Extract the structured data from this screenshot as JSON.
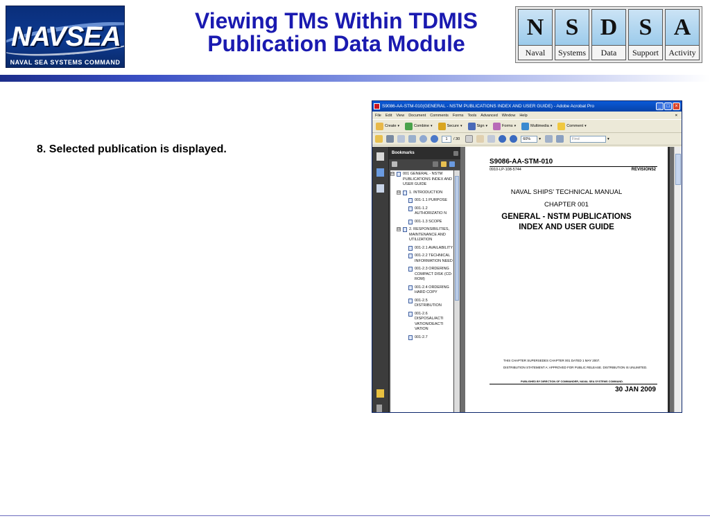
{
  "header": {
    "logo": {
      "word": "NAVSEA",
      "subtitle": "NAVAL SEA SYSTEMS COMMAND"
    },
    "title_line1": "Viewing TMs Within TDMIS",
    "title_line2": "Publication Data Module",
    "nsdsa": [
      {
        "letter": "N",
        "word": "Naval"
      },
      {
        "letter": "S",
        "word": "Systems"
      },
      {
        "letter": "D",
        "word": "Data"
      },
      {
        "letter": "S",
        "word": "Support"
      },
      {
        "letter": "A",
        "word": "Activity"
      }
    ]
  },
  "bullet": "8. Selected publication is displayed.",
  "acrobat": {
    "title": "S9086-AA-STM-010(GENERAL - NSTM PUBLICATIONS INDEX AND USER GUIDE) - Adobe Acrobat Pro",
    "window_buttons": {
      "minimize": "_",
      "maximize": "□",
      "close": "×"
    },
    "menu": [
      "File",
      "Edit",
      "View",
      "Document",
      "Comments",
      "Forms",
      "Tools",
      "Advanced",
      "Window",
      "Help"
    ],
    "menu_close": "×",
    "toolbar": [
      "Create",
      "Combine",
      "Secure",
      "Sign",
      "Forms",
      "Multimedia",
      "Comment"
    ],
    "page_current": "1",
    "page_total": "/ 30",
    "zoom": "60%",
    "find_placeholder": "Find",
    "bookmarks_title": "Bookmarks",
    "bookmarks": [
      {
        "label": "001   GENERAL - NSTM PUBLICATIONS INDEX AND USER GUIDE",
        "level": 0,
        "expander": "⊟"
      },
      {
        "label": "1. INTRODUCTION",
        "level": 1,
        "expander": "⊟"
      },
      {
        "label": "001-1.1 PURPOSE",
        "level": 2,
        "expander": ""
      },
      {
        "label": "001-1.2 AUTHORIZATIO N",
        "level": 2,
        "expander": ""
      },
      {
        "label": "001-1.3   SCOPE",
        "level": 2,
        "expander": ""
      },
      {
        "label": "2. RESPONSIBILITIES, MAINTENANCE AND UTILIZATION",
        "level": 1,
        "expander": "⊟"
      },
      {
        "label": "001-2.1 AVAILABILITY",
        "level": 2,
        "expander": ""
      },
      {
        "label": "001-2.2 TECHNICAL INFORMATION NEED",
        "level": 2,
        "expander": ""
      },
      {
        "label": "001-2.3 ORDERING COMPACT DISK (CD-ROM)",
        "level": 2,
        "expander": ""
      },
      {
        "label": "001-2.4 ORDERING HARD COPY",
        "level": 2,
        "expander": ""
      },
      {
        "label": "001-2.5 DISTRIBUTION",
        "level": 2,
        "expander": ""
      },
      {
        "label": "001-2.6 DISPOSAL/ACTI VATION/DEACTI VATION",
        "level": 2,
        "expander": ""
      },
      {
        "label": "001-2.7",
        "level": 2,
        "expander": ""
      }
    ],
    "page": {
      "doc_no": "S9086-AA-STM-010",
      "sub_left": "0910-LP-108-5744",
      "sub_right": "REVISION52",
      "manual": "NAVAL SHIPS' TECHNICAL MANUAL",
      "chapter": "CHAPTER 001",
      "heading": "GENERAL - NSTM PUBLICATIONS INDEX AND USER GUIDE",
      "supersedes": "THIS CHAPTER SUPERSEDES CHAPTER 001 DATED 1 MAY 2007.",
      "distribution": "DISTRIBUTION STATEMENT A: APPROVED FOR PUBLIC RELEASE. DISTRIBUTION IS UNLIMITED.",
      "published": "PUBLISHED BY DIRECTION OF COMMANDER, NAVAL SEA SYSTEMS COMMAND.",
      "date": "30 JAN 2009"
    }
  }
}
